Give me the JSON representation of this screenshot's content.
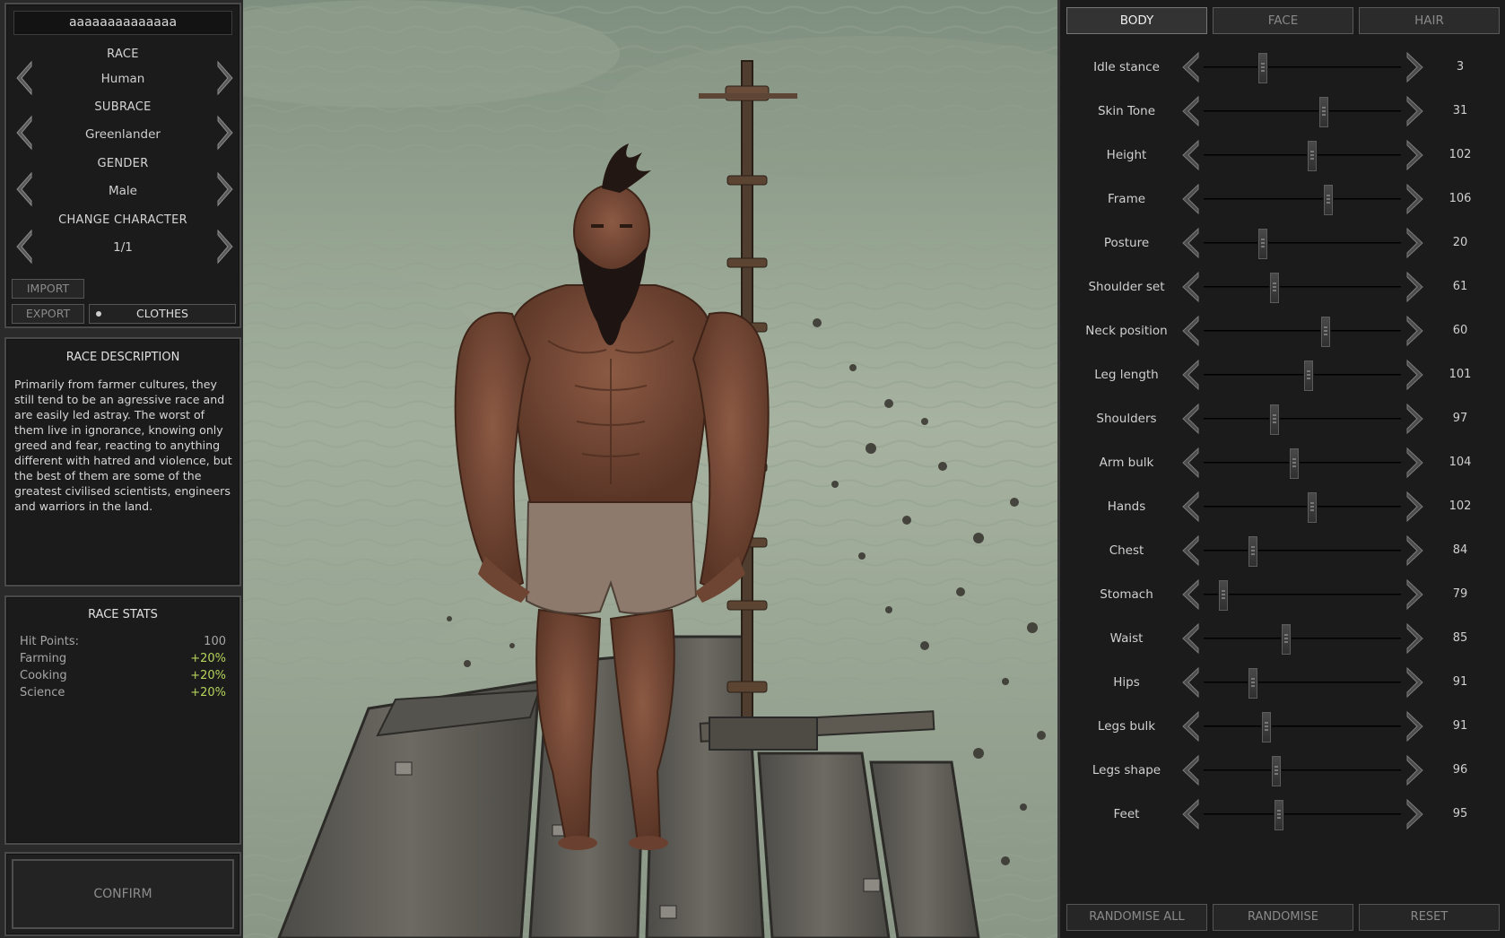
{
  "character": {
    "name": "aaaaaaaaaaaaaa",
    "race_label": "RACE",
    "race_value": "Human",
    "subrace_label": "SUBRACE",
    "subrace_value": "Greenlander",
    "gender_label": "GENDER",
    "gender_value": "Male",
    "change_label": "CHANGE CHARACTER",
    "change_value": "1/1",
    "import_label": "IMPORT",
    "export_label": "EXPORT",
    "clothes_label": "CLOTHES"
  },
  "description": {
    "title": "RACE DESCRIPTION",
    "text": "Primarily from farmer cultures, they still tend to be an agressive race and are easily led astray.  The worst of them live in ignorance, knowing only greed and fear, reacting to anything different with hatred and violence, but the best of them are some of the greatest civilised scientists, engineers and warriors in the land."
  },
  "stats": {
    "title": "RACE STATS",
    "rows": [
      {
        "label": "Hit Points:",
        "value": "100"
      },
      {
        "label": "Farming",
        "value": "+20%"
      },
      {
        "label": "Cooking",
        "value": "+20%"
      },
      {
        "label": "Science",
        "value": "+20%"
      }
    ]
  },
  "confirm_label": "CONFIRM",
  "tabs": [
    {
      "label": "BODY",
      "active": true
    },
    {
      "label": "FACE",
      "active": false
    },
    {
      "label": "HAIR",
      "active": false
    }
  ],
  "sliders": [
    {
      "label": "Idle stance",
      "value": "3",
      "level": 0.3
    },
    {
      "label": "Skin Tone",
      "value": "31",
      "level": 0.61
    },
    {
      "label": "Height",
      "value": "102",
      "level": 0.55
    },
    {
      "label": "Frame",
      "value": "106",
      "level": 0.63
    },
    {
      "label": "Posture",
      "value": "20",
      "level": 0.3
    },
    {
      "label": "Shoulder set",
      "value": "61",
      "level": 0.36
    },
    {
      "label": "Neck position",
      "value": "60",
      "level": 0.62
    },
    {
      "label": "Leg length",
      "value": "101",
      "level": 0.53
    },
    {
      "label": "Shoulders",
      "value": "97",
      "level": 0.36
    },
    {
      "label": "Arm bulk",
      "value": "104",
      "level": 0.46
    },
    {
      "label": "Hands",
      "value": "102",
      "level": 0.55
    },
    {
      "label": "Chest",
      "value": "84",
      "level": 0.25
    },
    {
      "label": "Stomach",
      "value": "79",
      "level": 0.1
    },
    {
      "label": "Waist",
      "value": "85",
      "level": 0.42
    },
    {
      "label": "Hips",
      "value": "91",
      "level": 0.25
    },
    {
      "label": "Legs bulk",
      "value": "91",
      "level": 0.32
    },
    {
      "label": "Legs shape",
      "value": "96",
      "level": 0.37
    },
    {
      "label": "Feet",
      "value": "95",
      "level": 0.38
    }
  ],
  "bottom_buttons": {
    "randomise_all": "RANDOMISE ALL",
    "randomise": "RANDOMISE",
    "reset": "RESET"
  },
  "icons": {
    "arrow_left": "arrow-left-icon",
    "arrow_right": "arrow-right-icon"
  }
}
